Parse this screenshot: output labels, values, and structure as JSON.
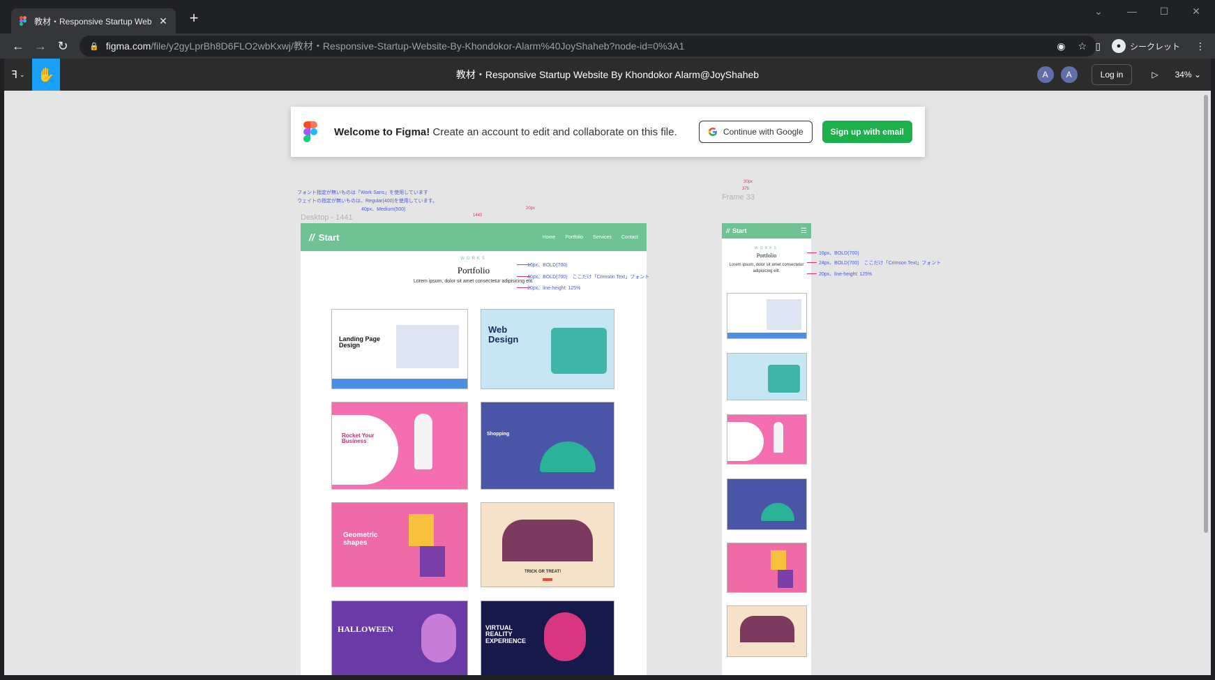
{
  "browser": {
    "tab_title": "教材・Responsive Startup Website By Khondokor Alarm@JoySha",
    "url_domain": "figma.com",
    "url_path": "/file/y2gyLprBh8D6FLO2wbKxwj/教材・Responsive-Startup-Website-By-Khondokor-Alarm%40JoyShaheb?node-id=0%3A1",
    "incognito_label": "シークレット"
  },
  "figma": {
    "file_name": "教材・Responsive Startup Website By Khondokor Alarm@JoyShaheb",
    "avatar_1": "A",
    "avatar_2": "A",
    "login_label": "Log in",
    "zoom": "34%",
    "accent": "#18a0fb"
  },
  "welcome": {
    "bold": "Welcome to Figma!",
    "text": " Create an account to edit and collaborate on this file.",
    "google_label": "Continue with Google",
    "email_label": "Sign up with email",
    "email_color": "#1bb04a"
  },
  "desktop": {
    "frame_label": "Desktop - 1441",
    "note_1": "フォント指定が無いものは「Work Sans」を使用しています",
    "note_2": "ウェイトの指定が無いものは、Regular(400)を使用しています。",
    "nav_spec": "40px、Medium(500)",
    "brand": "Start",
    "nav_links": [
      "Home",
      "Portfolio",
      "Services",
      "Contact"
    ],
    "works": "WORKS",
    "title": "Portfolio",
    "lead": "Lorem ipsum, dolor sit amet consectetur adipisicing elit.",
    "spec_1": "16px、BOLD(700)",
    "spec_2": "40px、BOLD(700)　ここだけ「Crimson Text」フォント",
    "spec_3": "20px、line-height: 125%",
    "cards": [
      {
        "title": "Landing Page Design"
      },
      {
        "title": "Web Design"
      },
      {
        "title": "Rocket Your Business"
      },
      {
        "title": "Shopping"
      },
      {
        "title": "Geometric shapes"
      },
      {
        "title": "TRICK OR TREAT!"
      },
      {
        "title": "HALLOWEEN"
      },
      {
        "title": "VIRTUAL REALITY EXPERIENCE"
      }
    ],
    "brand_color": "#6ec294"
  },
  "mobile": {
    "frame_label": "Frame 33",
    "brand": "Start",
    "works": "WORKS",
    "title": "Portfolio",
    "lead": "Lorem ipsum, dolor sit amet consectetur adipisicing elit.",
    "spec_1": "16px、BOLD(700)",
    "spec_2": "24px、BOLD(700)　ここだけ「Crimson Text」フォント",
    "spec_3": "20px、line-height: 125%"
  }
}
